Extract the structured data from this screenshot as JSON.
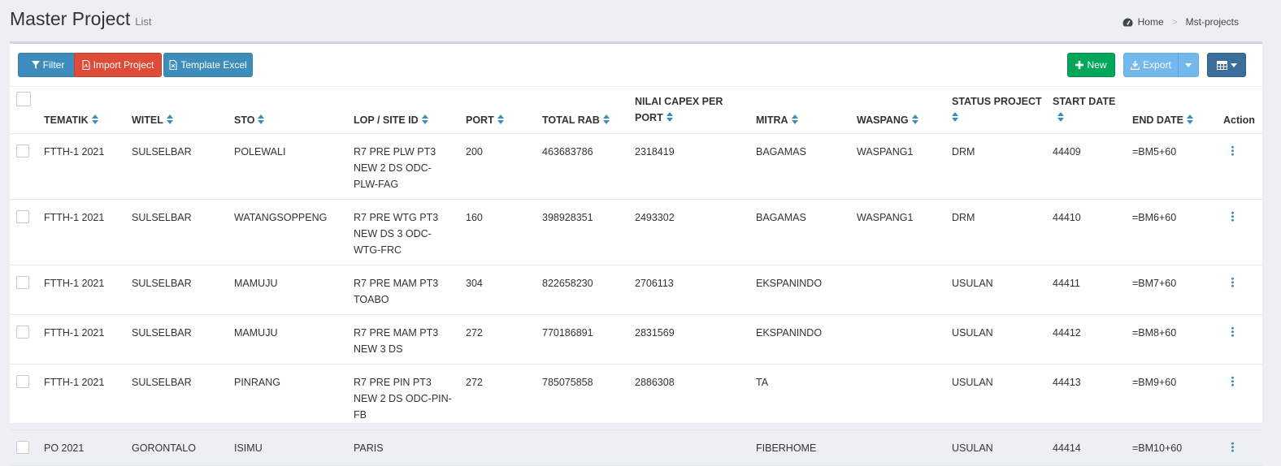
{
  "header": {
    "title": "Master Project",
    "subtitle": "List",
    "breadcrumb": {
      "home": "Home",
      "separator": ">",
      "current": "Mst-projects"
    }
  },
  "toolbar": {
    "filter": "Filter",
    "import_project": "Import Project",
    "template_excel": "Template Excel",
    "new": "New",
    "export": "Export"
  },
  "table": {
    "columns": {
      "tematik": "TEMATIK",
      "witel": "WITEL",
      "sto": "STO",
      "lop": "LOP / SITE ID",
      "port": "PORT",
      "total_rab": "TOTAL RAB",
      "nilai_capex_1": "NILAI CAPEX PER",
      "nilai_capex_2": "PORT",
      "mitra": "MITRA",
      "waspang": "WASPANG",
      "status_project": "STATUS PROJECT",
      "start_date": "START DATE",
      "end_date": "END DATE",
      "action": "Action"
    },
    "rows": [
      {
        "tematik": "FTTH-1 2021",
        "witel": "SULSELBAR",
        "sto": "POLEWALI",
        "lop": "R7 PRE PLW PT3 NEW 2 DS ODC-PLW-FAG",
        "port": "200",
        "total_rab": "463683786",
        "nilai_capex": "2318419",
        "mitra": "BAGAMAS",
        "waspang": "WASPANG1",
        "status": "DRM",
        "start_date": "44409",
        "end_date": "=BM5+60"
      },
      {
        "tematik": "FTTH-1 2021",
        "witel": "SULSELBAR",
        "sto": "WATANGSOPPENG",
        "lop": "R7 PRE WTG PT3 NEW DS 3 ODC-WTG-FRC",
        "port": "160",
        "total_rab": "398928351",
        "nilai_capex": "2493302",
        "mitra": "BAGAMAS",
        "waspang": "WASPANG1",
        "status": "DRM",
        "start_date": "44410",
        "end_date": "=BM6+60"
      },
      {
        "tematik": "FTTH-1 2021",
        "witel": "SULSELBAR",
        "sto": "MAMUJU",
        "lop": "R7 PRE MAM PT3 TOABO",
        "port": "304",
        "total_rab": "822658230",
        "nilai_capex": "2706113",
        "mitra": "EKSPANINDO",
        "waspang": "",
        "status": "USULAN",
        "start_date": "44411",
        "end_date": "=BM7+60"
      },
      {
        "tematik": "FTTH-1 2021",
        "witel": "SULSELBAR",
        "sto": "MAMUJU",
        "lop": "R7 PRE MAM PT3 NEW 3 DS",
        "port": "272",
        "total_rab": "770186891",
        "nilai_capex": "2831569",
        "mitra": "EKSPANINDO",
        "waspang": "",
        "status": "USULAN",
        "start_date": "44412",
        "end_date": "=BM8+60"
      },
      {
        "tematik": "FTTH-1 2021",
        "witel": "SULSELBAR",
        "sto": "PINRANG",
        "lop": "R7 PRE PIN PT3 NEW 2 DS ODC-PIN-FB",
        "port": "272",
        "total_rab": "785075858",
        "nilai_capex": "2886308",
        "mitra": "TA",
        "waspang": "",
        "status": "USULAN",
        "start_date": "44413",
        "end_date": "=BM9+60"
      },
      {
        "tematik": "PO 2021",
        "witel": "GORONTALO",
        "sto": "ISIMU",
        "lop": "PARIS",
        "port": "",
        "total_rab": "",
        "nilai_capex": "",
        "mitra": "FIBERHOME",
        "waspang": "",
        "status": "USULAN",
        "start_date": "44414",
        "end_date": "=BM10+60"
      }
    ]
  }
}
